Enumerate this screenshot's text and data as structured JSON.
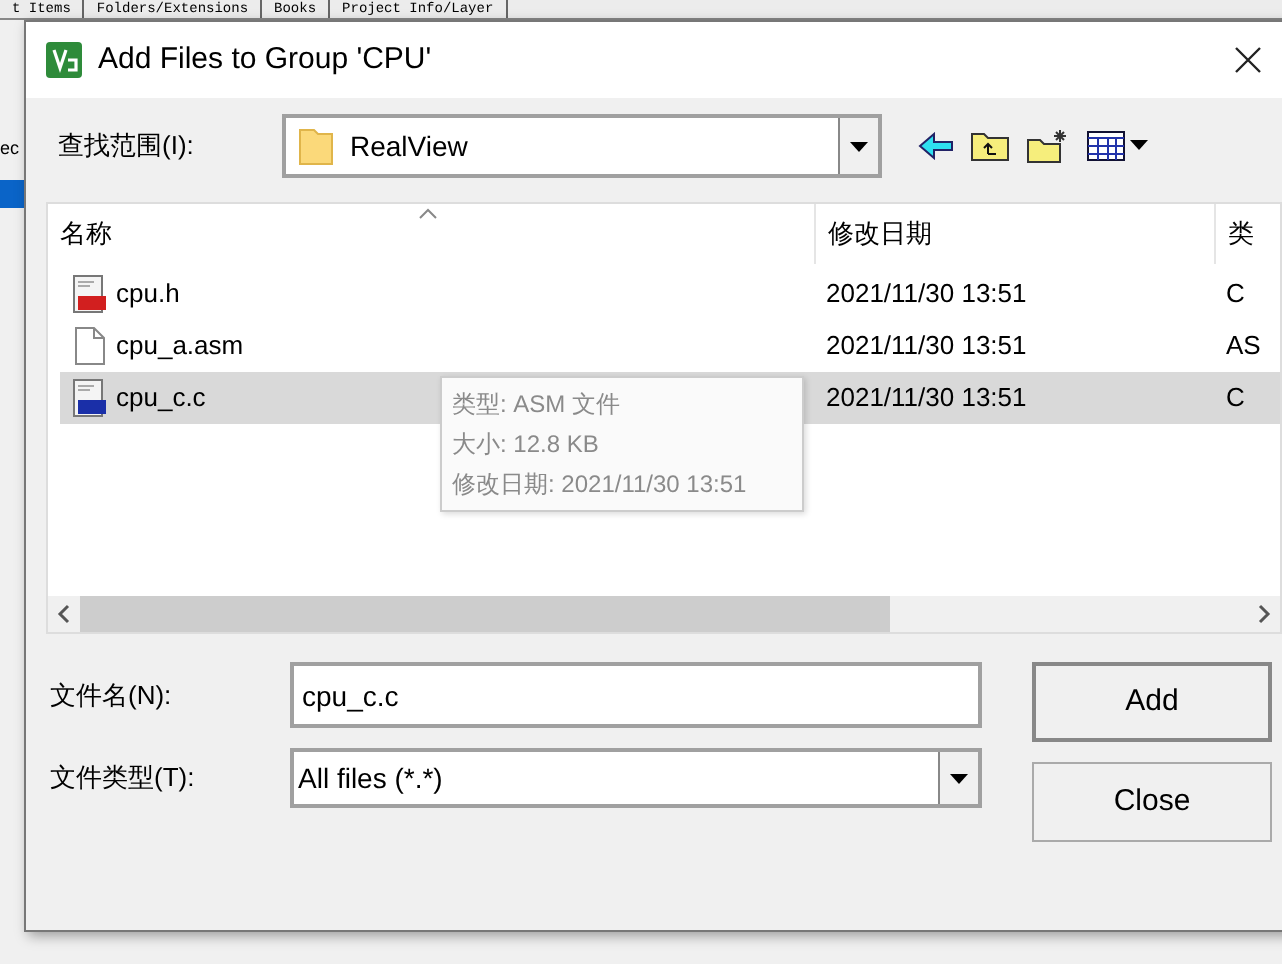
{
  "background": {
    "tabs": [
      "t Items",
      "Folders/Extensions",
      "Books",
      "Project Info/Layer"
    ],
    "side_text": "ec"
  },
  "window": {
    "title": "Add Files to Group 'CPU'"
  },
  "look_in": {
    "label": "查找范围(I):",
    "value": "RealView"
  },
  "file_list": {
    "columns": [
      "名称",
      "修改日期",
      "类"
    ],
    "rows": [
      {
        "name": "cpu.h",
        "kind": "header",
        "date": "2021/11/30 13:51",
        "type": "C",
        "selected": false
      },
      {
        "name": "cpu_a.asm",
        "kind": "plain",
        "date": "2021/11/30 13:51",
        "type": "AS",
        "selected": false
      },
      {
        "name": "cpu_c.c",
        "kind": "source",
        "date": "2021/11/30 13:51",
        "type": "C",
        "selected": true
      }
    ],
    "tooltip": [
      "类型: ASM 文件",
      "大小: 12.8 KB",
      "修改日期: 2021/11/30 13:51"
    ]
  },
  "file_name": {
    "label": "文件名(N):",
    "value": "cpu_c.c"
  },
  "file_type": {
    "label": "文件类型(T):",
    "value": "All files (*.*)"
  },
  "buttons": [
    "Add",
    "Close"
  ]
}
